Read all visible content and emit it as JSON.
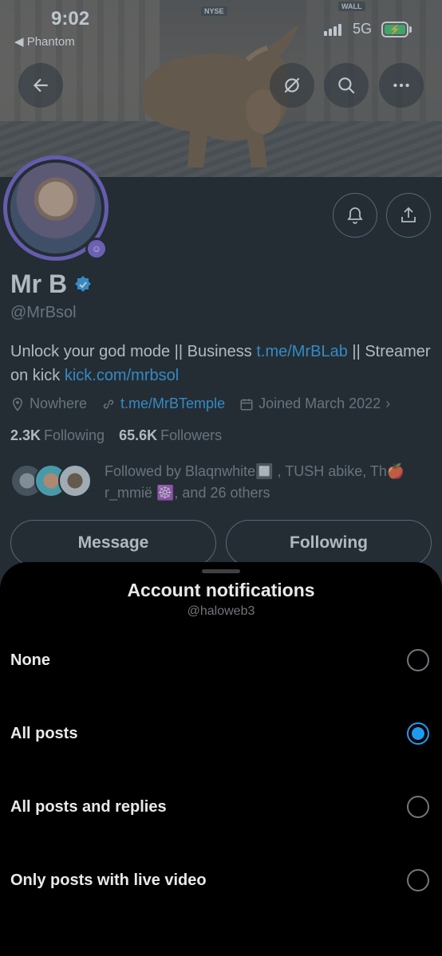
{
  "status_bar": {
    "time": "9:02",
    "back_app": "◀ Phantom",
    "network": "5G"
  },
  "banner": {
    "sign_1": "NYSE",
    "sign_2": "WALL"
  },
  "profile": {
    "name": "Mr B",
    "handle": "@MrBsol",
    "bio_text_1": "Unlock your god mode || Business ",
    "bio_link_1": "t.me/MrBLab",
    "bio_text_2": " || Streamer on kick ",
    "bio_link_2": "kick.com/mrbsol",
    "location": "Nowhere",
    "website": "t.me/MrBTemple",
    "joined": "Joined March 2022",
    "following_count": "2.3K",
    "following_label": "Following",
    "followers_count": "65.6K",
    "followers_label": "Followers",
    "followed_by": "Followed by Blaqnwhite🔲 , TUSH abike, Th🍎 r_mmië ☸️, and 26 others",
    "message_button": "Message",
    "following_button": "Following"
  },
  "sheet": {
    "title": "Account notifications",
    "subtitle": "@haloweb3",
    "options": [
      {
        "label": "None",
        "selected": false
      },
      {
        "label": "All posts",
        "selected": true
      },
      {
        "label": "All posts and replies",
        "selected": false
      },
      {
        "label": "Only posts with live video",
        "selected": false
      }
    ]
  },
  "colors": {
    "accent": "#1d9bf0",
    "avatar_ring": "#6f4fc8",
    "background": "#000000",
    "muted": "#71767b"
  }
}
